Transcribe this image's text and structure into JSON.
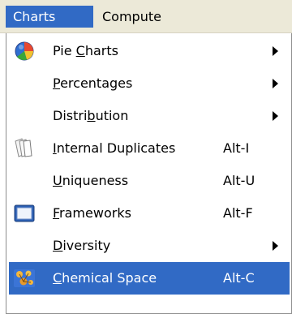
{
  "menubar": {
    "items": [
      {
        "label": "Charts",
        "active": true
      },
      {
        "label": "Compute",
        "active": false
      }
    ]
  },
  "menu": {
    "items": [
      {
        "pre": "Pie ",
        "mnemonic": "C",
        "post": "harts",
        "shortcut": "",
        "submenu": true,
        "icon": "pie-chart-icon"
      },
      {
        "pre": "",
        "mnemonic": "P",
        "post": "ercentages",
        "shortcut": "",
        "submenu": true,
        "icon": ""
      },
      {
        "pre": "Distri",
        "mnemonic": "b",
        "post": "ution",
        "shortcut": "",
        "submenu": true,
        "icon": ""
      },
      {
        "pre": "",
        "mnemonic": "I",
        "post": "nternal Duplicates",
        "shortcut": "Alt-I",
        "submenu": false,
        "icon": "duplicate-pages-icon"
      },
      {
        "pre": "",
        "mnemonic": "U",
        "post": "niqueness",
        "shortcut": "Alt-U",
        "submenu": false,
        "icon": ""
      },
      {
        "pre": "",
        "mnemonic": "F",
        "post": "rameworks",
        "shortcut": "Alt-F",
        "submenu": false,
        "icon": "framework-window-icon"
      },
      {
        "pre": "",
        "mnemonic": "D",
        "post": "iversity",
        "shortcut": "",
        "submenu": true,
        "icon": ""
      },
      {
        "pre": "",
        "mnemonic": "C",
        "post": "hemical Space",
        "shortcut": "Alt-C",
        "submenu": false,
        "icon": "chemical-space-icon",
        "highlighted": true
      }
    ]
  },
  "colors": {
    "menubar_bg": "#ece9d8",
    "highlight": "#316ac5",
    "highlight_text": "#ffffff"
  }
}
